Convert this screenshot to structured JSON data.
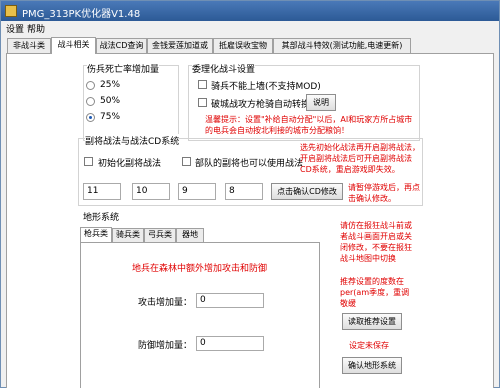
{
  "window": {
    "title": "PMG_313PK优化器V1.48"
  },
  "menu": {
    "items": [
      "设置",
      "帮助"
    ]
  },
  "tabs": [
    "非战斗类",
    "战斗相关",
    "战法CD查询",
    "金钱爱莲加道或",
    "抵雇误收宝物",
    "其部战斗特效(测试功能,电速更新)"
  ],
  "death_section": {
    "label": "伤兵死亡率增加量",
    "options": [
      "25%",
      "50%",
      "75%"
    ],
    "selected_index": 2
  },
  "ai_section": {
    "label": "委理化战斗设置",
    "option1": "骑兵不能上墙(不支持MOD)",
    "option2": "破城战攻方枪骑自动转换",
    "explain_button": "说明",
    "note": "温馨提示：设置\"补给自动分配\"以后，AI和玩家方所占城市的电兵会自动按北利接的城市分配粮饷！"
  },
  "cd_section": {
    "label": "副将战法与战法CD系统",
    "checkbox1": "初始化副将战法",
    "checkbox2": "部队的副将也可以使用战法",
    "note": "选先初始化战法再开启副将战法，开启副将战法后可开启副将战法CD系统，重启游戏即失效。",
    "values": [
      "11",
      "10",
      "9",
      "8"
    ],
    "confirm_button": "点击确认CD修改",
    "confirm_note": "请暂停游戏后，再点击确认修改。"
  },
  "terrain_section": {
    "label": "地形系统",
    "subtabs": [
      "枪兵类",
      "骑兵类",
      "弓兵类",
      "器地"
    ],
    "hint": "地兵在森林中额外增加攻击和防御",
    "attack_label": "攻击增加量：",
    "attack_value": "0",
    "defense_label": "防御增加量：",
    "defense_value": "0",
    "right_note1": "请仿在报狂战斗前或者战斗画面开启或关闭修改，不要在报狂战斗地图中切换",
    "right_note2": "推荐设置的度数在per(am季度，重调敬缓",
    "read_button": "读取推荐设置",
    "right_note3": "设定未保存",
    "confirm_button": "确认地形系统"
  }
}
